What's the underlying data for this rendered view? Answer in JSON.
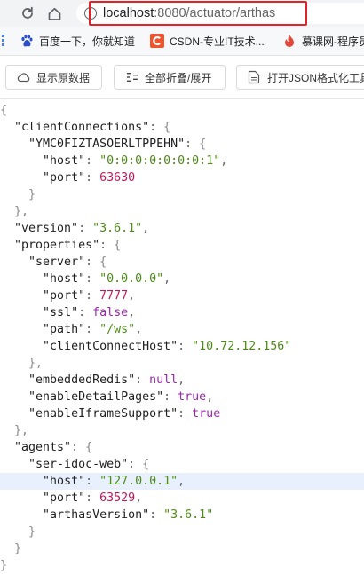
{
  "browser": {
    "url_host": "localhost",
    "url_rest": ":8080/actuator/arthas",
    "bookmarks": [
      {
        "label": "百度一下，你就知道"
      },
      {
        "label": "CSDN-专业IT技术..."
      },
      {
        "label": "慕课网-程序员"
      }
    ]
  },
  "viewer": {
    "buttons": {
      "raw": "显示原数据",
      "toggle": "全部折叠/展开",
      "open_formatter": "打开JSON格式化工具"
    },
    "icons": {
      "raw": "cloud-icon",
      "toggle": "collapse-icon",
      "open_formatter": "document-icon"
    }
  },
  "json": {
    "lines": [
      {
        "indent": 0,
        "open": "{"
      },
      {
        "indent": 1,
        "key": "clientConnections",
        "open": "{"
      },
      {
        "indent": 2,
        "key": "YMC0FIZTASOERLTPPEHN",
        "open": "{"
      },
      {
        "indent": 3,
        "key": "host",
        "value": "0:0:0:0:0:0:0:1",
        "type": "string",
        "comma": true
      },
      {
        "indent": 3,
        "key": "port",
        "value": "63630",
        "type": "number"
      },
      {
        "indent": 2,
        "close": "}"
      },
      {
        "indent": 1,
        "close": "},"
      },
      {
        "indent": 1,
        "key": "version",
        "value": "3.6.1",
        "type": "string",
        "comma": true
      },
      {
        "indent": 1,
        "key": "properties",
        "open": "{"
      },
      {
        "indent": 2,
        "key": "server",
        "open": "{"
      },
      {
        "indent": 3,
        "key": "host",
        "value": "0.0.0.0",
        "type": "string",
        "comma": true
      },
      {
        "indent": 3,
        "key": "port",
        "value": "7777",
        "type": "number",
        "comma": true
      },
      {
        "indent": 3,
        "key": "ssl",
        "value": "false",
        "type": "bool",
        "comma": true
      },
      {
        "indent": 3,
        "key": "path",
        "value": "/ws",
        "type": "string",
        "comma": true
      },
      {
        "indent": 3,
        "key": "clientConnectHost",
        "value": "10.72.12.156",
        "type": "string"
      },
      {
        "indent": 2,
        "close": "},"
      },
      {
        "indent": 2,
        "key": "embeddedRedis",
        "value": "null",
        "type": "bool",
        "comma": true
      },
      {
        "indent": 2,
        "key": "enableDetailPages",
        "value": "true",
        "type": "bool",
        "comma": true
      },
      {
        "indent": 2,
        "key": "enableIframeSupport",
        "value": "true",
        "type": "bool"
      },
      {
        "indent": 1,
        "close": "},"
      },
      {
        "indent": 1,
        "key": "agents",
        "open": "{"
      },
      {
        "indent": 2,
        "key": "ser-idoc-web",
        "open": "{"
      },
      {
        "indent": 3,
        "key": "host",
        "value": "127.0.0.1",
        "type": "string",
        "comma": true,
        "highlight": true
      },
      {
        "indent": 3,
        "key": "port",
        "value": "63529",
        "type": "number",
        "comma": true
      },
      {
        "indent": 3,
        "key": "arthasVersion",
        "value": "3.6.1",
        "type": "string"
      },
      {
        "indent": 2,
        "close": "}"
      },
      {
        "indent": 1,
        "close": "}"
      },
      {
        "indent": 0,
        "close": "}"
      }
    ]
  },
  "colors": {
    "url_highlight_border": "#e0242a",
    "string": "#4c8c14",
    "number": "#c2185b",
    "bool": "#9c27b0",
    "row_highlight": "#e8f0fe"
  }
}
